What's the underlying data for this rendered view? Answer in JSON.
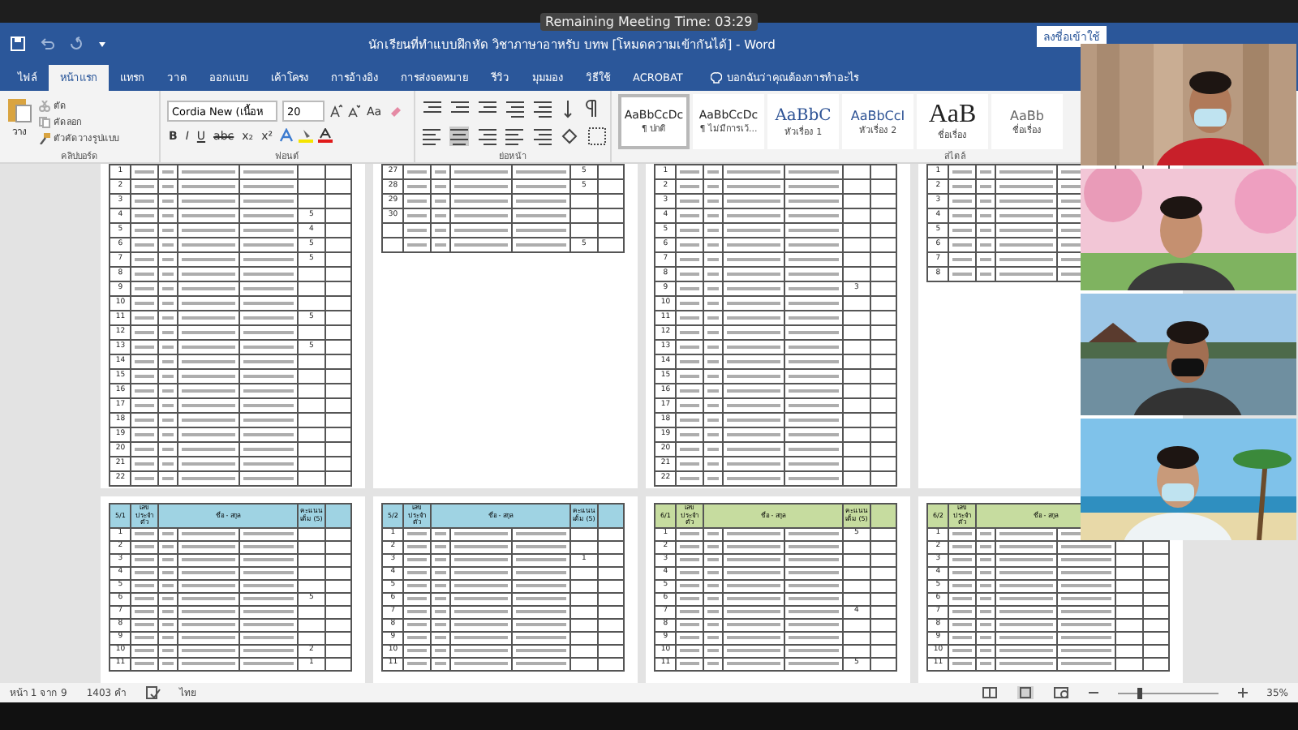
{
  "meeting_timer": "Remaining Meeting Time: 03:29",
  "window": {
    "title": "นักเรียนที่ทำแบบฝึกหัด วิชาภาษาอาหรับ บทพ [โหมดความเข้ากันได้]  -  Word",
    "sign_in": "ลงชื่อเข้าใช้"
  },
  "tabs": [
    {
      "label": "ไฟล์",
      "selected": false
    },
    {
      "label": "หน้าแรก",
      "selected": true
    },
    {
      "label": "แทรก",
      "selected": false
    },
    {
      "label": "วาด",
      "selected": false
    },
    {
      "label": "ออกแบบ",
      "selected": false
    },
    {
      "label": "เค้าโครง",
      "selected": false
    },
    {
      "label": "การอ้างอิง",
      "selected": false
    },
    {
      "label": "การส่งจดหมาย",
      "selected": false
    },
    {
      "label": "รีวิว",
      "selected": false
    },
    {
      "label": "มุมมอง",
      "selected": false
    },
    {
      "label": "วิธีใช้",
      "selected": false
    },
    {
      "label": "ACROBAT",
      "selected": false
    }
  ],
  "tell_me": "บอกฉันว่าคุณต้องการทำอะไร",
  "ribbon": {
    "clipboard": {
      "paste": "วาง",
      "cut": "ตัด",
      "copy": "คัดลอก",
      "format_painter": "ตัวคัดวางรูปแบบ",
      "label": "คลิปบอร์ด"
    },
    "font": {
      "name": "Cordia New (เนื้อห",
      "size": "20",
      "case": "Aa",
      "buttons": [
        "B",
        "I",
        "U",
        "abc",
        "x₂",
        "x²"
      ],
      "label": "ฟอนต์"
    },
    "paragraph": {
      "label": "ย่อหน้า"
    },
    "styles": {
      "items": [
        {
          "sample": "AaBbCcDc",
          "name": "¶ ปกติ",
          "selected": true,
          "kind": "body"
        },
        {
          "sample": "AaBbCcDc",
          "name": "¶ ไม่มีการเว้...",
          "selected": false,
          "kind": "body"
        },
        {
          "sample": "AaBbC",
          "name": "หัวเรื่อง 1",
          "selected": false,
          "kind": "heading1"
        },
        {
          "sample": "AaBbCcI",
          "name": "หัวเรื่อง 2",
          "selected": false,
          "kind": "heading2"
        },
        {
          "sample": "AaB",
          "name": "ชื่อเรื่อง",
          "selected": false,
          "kind": "title"
        },
        {
          "sample": "AaBb",
          "name": "ชื่อเรื่อง",
          "selected": false,
          "kind": "subtitle"
        }
      ],
      "label": "สไตล์"
    }
  },
  "pages_top": [
    {
      "rows": [
        {
          "no": "1",
          "score": ""
        },
        {
          "no": "2",
          "score": ""
        },
        {
          "no": "3",
          "score": ""
        },
        {
          "no": "4",
          "score": "5"
        },
        {
          "no": "5",
          "score": "4"
        },
        {
          "no": "6",
          "score": "5"
        },
        {
          "no": "7",
          "score": "5"
        },
        {
          "no": "8",
          "score": ""
        },
        {
          "no": "9",
          "score": ""
        },
        {
          "no": "10",
          "score": ""
        },
        {
          "no": "11",
          "score": "5"
        },
        {
          "no": "12",
          "score": ""
        },
        {
          "no": "13",
          "score": "5"
        },
        {
          "no": "14",
          "score": ""
        },
        {
          "no": "15",
          "score": ""
        },
        {
          "no": "16",
          "score": ""
        },
        {
          "no": "17",
          "score": ""
        },
        {
          "no": "18",
          "score": ""
        },
        {
          "no": "19",
          "score": ""
        },
        {
          "no": "20",
          "score": ""
        },
        {
          "no": "21",
          "score": ""
        },
        {
          "no": "22",
          "score": ""
        }
      ]
    },
    {
      "rows": [
        {
          "no": "27",
          "score": "5"
        },
        {
          "no": "28",
          "score": "5"
        },
        {
          "no": "29",
          "score": ""
        },
        {
          "no": "30",
          "score": ""
        },
        {
          "no": "",
          "score": ""
        },
        {
          "no": "",
          "score": "5"
        }
      ]
    },
    {
      "rows": [
        {
          "no": "1",
          "score": ""
        },
        {
          "no": "2",
          "score": ""
        },
        {
          "no": "3",
          "score": ""
        },
        {
          "no": "4",
          "score": ""
        },
        {
          "no": "5",
          "score": ""
        },
        {
          "no": "6",
          "score": ""
        },
        {
          "no": "7",
          "score": ""
        },
        {
          "no": "8",
          "score": ""
        },
        {
          "no": "9",
          "score": "3"
        },
        {
          "no": "10",
          "score": ""
        },
        {
          "no": "11",
          "score": ""
        },
        {
          "no": "12",
          "score": ""
        },
        {
          "no": "13",
          "score": ""
        },
        {
          "no": "14",
          "score": ""
        },
        {
          "no": "15",
          "score": ""
        },
        {
          "no": "16",
          "score": ""
        },
        {
          "no": "17",
          "score": ""
        },
        {
          "no": "18",
          "score": ""
        },
        {
          "no": "19",
          "score": ""
        },
        {
          "no": "20",
          "score": ""
        },
        {
          "no": "21",
          "score": ""
        },
        {
          "no": "22",
          "score": ""
        }
      ]
    },
    {
      "rows": [
        {
          "no": "1",
          "score": ""
        },
        {
          "no": "2",
          "score": ""
        },
        {
          "no": "3",
          "score": ""
        },
        {
          "no": "4",
          "score": ""
        },
        {
          "no": "5",
          "score": ""
        },
        {
          "no": "6",
          "score": ""
        },
        {
          "no": "7",
          "score": ""
        },
        {
          "no": "8",
          "score": ""
        }
      ]
    }
  ],
  "pages_bottom": [
    {
      "class": "5/1",
      "color": "#9fd3e3",
      "columns": [
        "เลข ประจำตัว",
        "ชื่อ - สกุล",
        "คะแนน เต็ม (5)"
      ],
      "rows": [
        {
          "no": "1",
          "score": ""
        },
        {
          "no": "2",
          "score": ""
        },
        {
          "no": "3",
          "score": ""
        },
        {
          "no": "4",
          "score": ""
        },
        {
          "no": "5",
          "score": ""
        },
        {
          "no": "6",
          "score": "5"
        },
        {
          "no": "7",
          "score": ""
        },
        {
          "no": "8",
          "score": ""
        },
        {
          "no": "9",
          "score": ""
        },
        {
          "no": "10",
          "score": "2"
        },
        {
          "no": "11",
          "score": "1"
        }
      ]
    },
    {
      "class": "5/2",
      "color": "#9fd3e3",
      "columns": [
        "เลข ประจำตัว",
        "ชื่อ - สกุล",
        "คะแนน เต็ม (5)"
      ],
      "rows": [
        {
          "no": "1",
          "score": ""
        },
        {
          "no": "2",
          "score": ""
        },
        {
          "no": "3",
          "score": "1"
        },
        {
          "no": "4",
          "score": ""
        },
        {
          "no": "5",
          "score": ""
        },
        {
          "no": "6",
          "score": ""
        },
        {
          "no": "7",
          "score": ""
        },
        {
          "no": "8",
          "score": ""
        },
        {
          "no": "9",
          "score": ""
        },
        {
          "no": "10",
          "score": ""
        },
        {
          "no": "11",
          "score": ""
        }
      ]
    },
    {
      "class": "6/1",
      "color": "#c6dc9f",
      "columns": [
        "เลข ประจำตัว",
        "ชื่อ - สกุล",
        "คะแนน เต็ม (5)"
      ],
      "rows": [
        {
          "no": "1",
          "score": "5"
        },
        {
          "no": "2",
          "score": ""
        },
        {
          "no": "3",
          "score": ""
        },
        {
          "no": "4",
          "score": ""
        },
        {
          "no": "5",
          "score": ""
        },
        {
          "no": "6",
          "score": ""
        },
        {
          "no": "7",
          "score": "4"
        },
        {
          "no": "8",
          "score": ""
        },
        {
          "no": "9",
          "score": ""
        },
        {
          "no": "10",
          "score": ""
        },
        {
          "no": "11",
          "score": "5"
        }
      ]
    },
    {
      "class": "6/2",
      "color": "#c6dc9f",
      "columns": [
        "เลข ประจำตัว",
        "ชื่อ - สกุล"
      ],
      "rows": [
        {
          "no": "1",
          "score": ""
        },
        {
          "no": "2",
          "score": ""
        },
        {
          "no": "3",
          "score": ""
        },
        {
          "no": "4",
          "score": ""
        },
        {
          "no": "5",
          "score": ""
        },
        {
          "no": "6",
          "score": ""
        },
        {
          "no": "7",
          "score": ""
        },
        {
          "no": "8",
          "score": ""
        },
        {
          "no": "9",
          "score": ""
        },
        {
          "no": "10",
          "score": ""
        },
        {
          "no": "11",
          "score": ""
        }
      ]
    }
  ],
  "status_bar": {
    "page": "หน้า 1 จาก 9",
    "words": "1403 คำ",
    "language": "ไทย",
    "zoom": "35%",
    "level": 0.2
  }
}
